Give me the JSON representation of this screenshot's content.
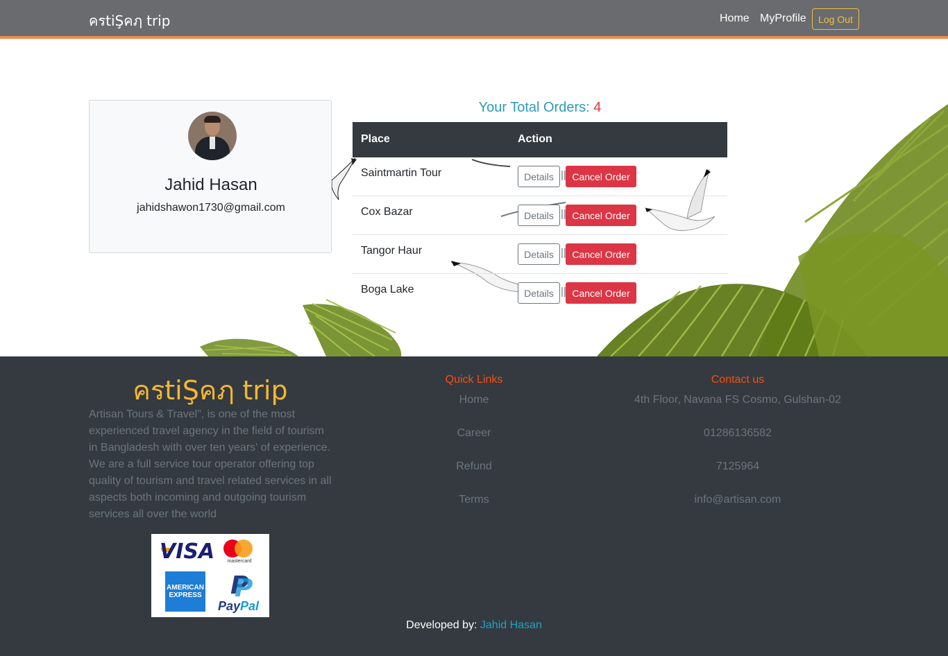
{
  "nav": {
    "brand": "ครtiŞคฦ trip",
    "home": "Home",
    "profile": "MyProfile",
    "logout": "Log Out"
  },
  "profile": {
    "name": "Jahid Hasan",
    "email": "jahidshawon1730@gmail.com"
  },
  "orders": {
    "title": "Your Total Orders: ",
    "count": "4",
    "headers": {
      "place": "Place",
      "action": "Action"
    },
    "details_label": "Details",
    "separator": "||",
    "cancel_label": "Cancel Order",
    "rows": [
      {
        "place": "Saintmartin Tour"
      },
      {
        "place": "Cox Bazar"
      },
      {
        "place": "Tangor Haur"
      },
      {
        "place": "Boga Lake"
      }
    ]
  },
  "footer": {
    "brand": "ครtiŞคฦ trip",
    "about": "Artisan Tours & Travel\", is one of the most experienced travel agency in the field of tourism in Bangladesh with over ten years' of experience. We are a full service tour operator offering top quality of tourism and travel related services in all aspects both incoming and outgoing tourism services all over the world",
    "payments": {
      "visa": "VISA",
      "mastercard": "mastercard",
      "amex": "AMERICAN EXPRESS",
      "paypal_a": "Pay",
      "paypal_b": "Pal",
      "paypal_p": "P"
    },
    "quick_links": {
      "heading": "Quick Links",
      "items": [
        "Home",
        "Career",
        "Refund",
        "Terms"
      ]
    },
    "contact": {
      "heading": "Contact us",
      "items": [
        "4th Floor, Navana FS Cosmo, Gulshan-02",
        "01286136582",
        "7125964",
        "info@artisan.com"
      ]
    },
    "developer_prefix": "Developed by: ",
    "developer_name": "Jahid Hasan"
  },
  "colors": {
    "navbar": "#6a6b6e",
    "accent": "#f08a4b",
    "danger": "#dc3545",
    "info": "#2d9bb7",
    "footer_bg": "#343a40",
    "footer_heading": "#fd4d0d",
    "brand_gold": "#f5b731"
  },
  "icons": [
    "seagull-icon",
    "palm-leaf-icon"
  ]
}
